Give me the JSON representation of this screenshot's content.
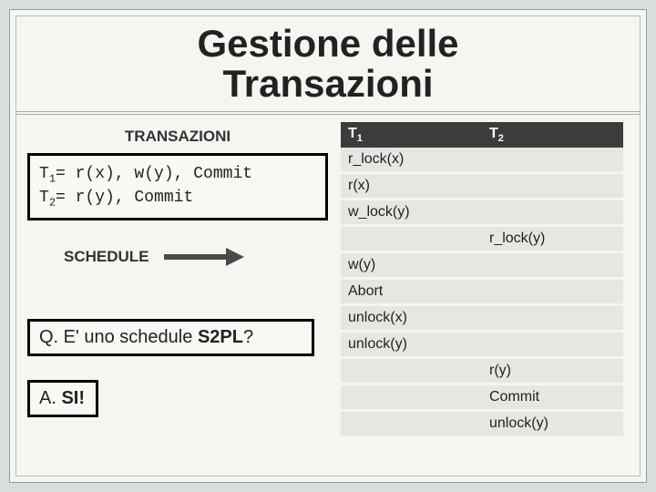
{
  "title_line1": "Gestione delle",
  "title_line2": "Transazioni",
  "left": {
    "transazioni_heading": "TRANSAZIONI",
    "t1_label": "T",
    "t1_sub": "1",
    "t1_def": "= r(x), w(y), Commit",
    "t2_label": "T",
    "t2_sub": "2",
    "t2_def": "= r(y), Commit",
    "schedule_heading": "SCHEDULE",
    "q_prefix": "Q. E' uno schedule ",
    "q_bold": "S2PL",
    "q_suffix": "?",
    "a_prefix": "A. ",
    "a_bold": "SI!"
  },
  "table": {
    "h1": "T",
    "h1_sub": "1",
    "h2": "T",
    "h2_sub": "2",
    "rows": [
      {
        "c1": "r_lock(x)",
        "c2": ""
      },
      {
        "c1": "r(x)",
        "c2": ""
      },
      {
        "c1": "w_lock(y)",
        "c2": ""
      },
      {
        "c1": "",
        "c2": "r_lock(y)"
      },
      {
        "c1": "w(y)",
        "c2": ""
      },
      {
        "c1": "Abort",
        "c2": ""
      },
      {
        "c1": "unlock(x)",
        "c2": ""
      },
      {
        "c1": "unlock(y)",
        "c2": ""
      },
      {
        "c1": "",
        "c2": "r(y)"
      },
      {
        "c1": "",
        "c2": "Commit"
      },
      {
        "c1": "",
        "c2": "unlock(y)"
      }
    ]
  },
  "chart_data": {
    "type": "table",
    "title": "Schedule (two-phase locking example)",
    "columns": [
      "T1",
      "T2"
    ],
    "rows": [
      [
        "r_lock(x)",
        ""
      ],
      [
        "r(x)",
        ""
      ],
      [
        "w_lock(y)",
        ""
      ],
      [
        "",
        "r_lock(y)"
      ],
      [
        "w(y)",
        ""
      ],
      [
        "Abort",
        ""
      ],
      [
        "unlock(x)",
        ""
      ],
      [
        "unlock(y)",
        ""
      ],
      [
        "",
        "r(y)"
      ],
      [
        "",
        "Commit"
      ],
      [
        "",
        "unlock(y)"
      ]
    ]
  }
}
